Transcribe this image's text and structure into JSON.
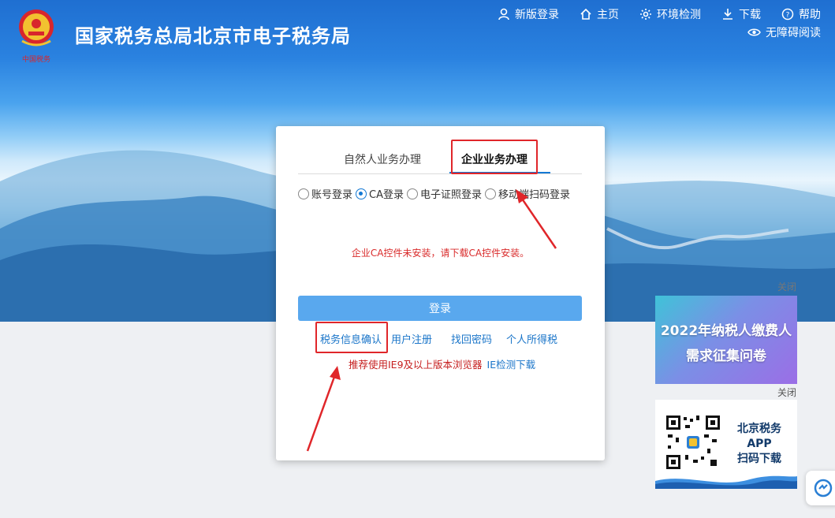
{
  "header": {
    "site_title": "国家税务总局北京市电子税务局",
    "nav": [
      {
        "icon": "user-icon",
        "label": "新版登录"
      },
      {
        "icon": "home-icon",
        "label": "主页"
      },
      {
        "icon": "settings-icon",
        "label": "环境检测"
      },
      {
        "icon": "download-icon",
        "label": "下载"
      },
      {
        "icon": "help-icon",
        "label": "帮助"
      }
    ],
    "accessibility": {
      "icon": "eye-icon",
      "label": "无障碍阅读"
    }
  },
  "login": {
    "tabs": [
      {
        "label": "自然人业务办理",
        "active": false
      },
      {
        "label": "企业业务办理",
        "active": true
      }
    ],
    "methods": [
      {
        "label": "账号登录",
        "selected": false
      },
      {
        "label": "CA登录",
        "selected": true
      },
      {
        "label": "电子证照登录",
        "selected": false
      },
      {
        "label": "移动端扫码登录",
        "selected": false
      }
    ],
    "warning": "企业CA控件未安装，请下载CA控件安装。",
    "login_button": "登录",
    "links": [
      "税务信息确认",
      "用户注册",
      "找回密码",
      "个人所得税"
    ],
    "recommend": "推荐使用IE9及以上版本浏览器",
    "ie_download": "IE检测下载"
  },
  "ads": {
    "close_label_1": "关闭",
    "ad1_line1": "2022年纳税人缴费人",
    "ad1_line2": "需求征集问卷",
    "close_label_2": "关闭",
    "ad2_lines": [
      "北京税务",
      "APP",
      "扫码下载"
    ]
  },
  "colors": {
    "primary": "#1479d4",
    "login_button": "#59a8ee",
    "warning": "#d92b2b",
    "highlight": "#e0262a"
  }
}
